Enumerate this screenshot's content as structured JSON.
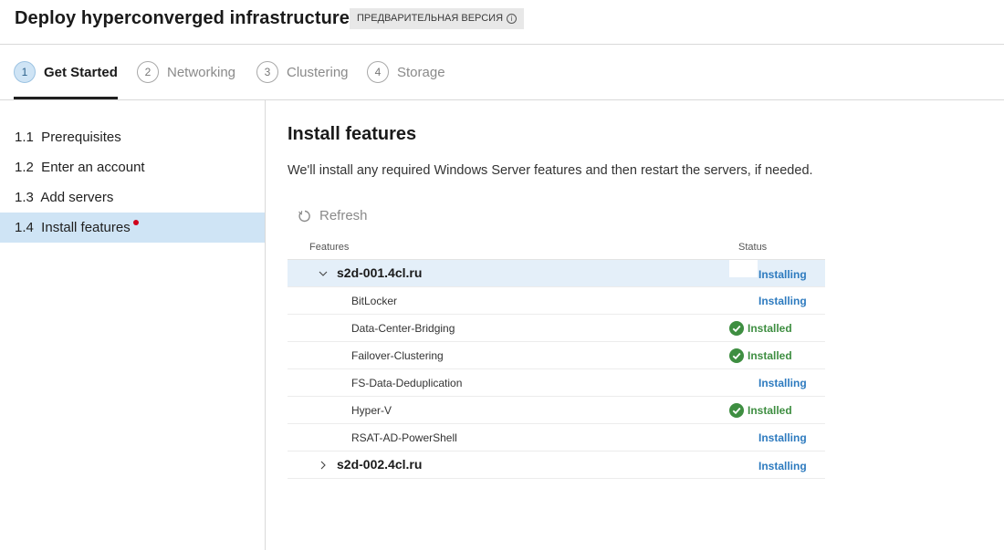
{
  "header": {
    "title": "Deploy hyperconverged infrastructure",
    "badge": "ПРЕДВАРИТЕЛЬНАЯ ВЕРСИЯ",
    "badge_icon": "info-icon"
  },
  "steps": [
    {
      "number": "1",
      "label": "Get Started",
      "active": true
    },
    {
      "number": "2",
      "label": "Networking",
      "active": false
    },
    {
      "number": "3",
      "label": "Clustering",
      "active": false
    },
    {
      "number": "4",
      "label": "Storage",
      "active": false
    }
  ],
  "sidebar": {
    "items": [
      {
        "label": "1.1  Prerequisites"
      },
      {
        "label": "1.2  Enter an account"
      },
      {
        "label": "1.3  Add servers"
      },
      {
        "label": "1.4  Install features",
        "selected": true,
        "indicator_color": "#d0021b"
      }
    ]
  },
  "main": {
    "title": "Install features",
    "description": "We'll install any required Windows Server features and then restart the servers, if needed.",
    "refresh_label": "Refresh",
    "refresh_icon": "refresh-icon"
  },
  "table": {
    "col_features": "Features",
    "col_status": "Status",
    "server1": {
      "name": "s2d-001.4cl.ru",
      "status": "Installing",
      "expanded": true
    },
    "features": [
      {
        "name": "BitLocker",
        "status": "Installing"
      },
      {
        "name": "Data-Center-Bridging",
        "status": "Installed"
      },
      {
        "name": "Failover-Clustering",
        "status": "Installed"
      },
      {
        "name": "FS-Data-Deduplication",
        "status": "Installing"
      },
      {
        "name": "Hyper-V",
        "status": "Installed"
      },
      {
        "name": "RSAT-AD-PowerShell",
        "status": "Installing"
      }
    ],
    "server2": {
      "name": "s2d-002.4cl.ru",
      "status": "Installing",
      "expanded": false
    }
  },
  "colors": {
    "accent": "#2e7bbf",
    "installed_green": "#3e8e41",
    "selected_bg": "#cfe4f5"
  }
}
